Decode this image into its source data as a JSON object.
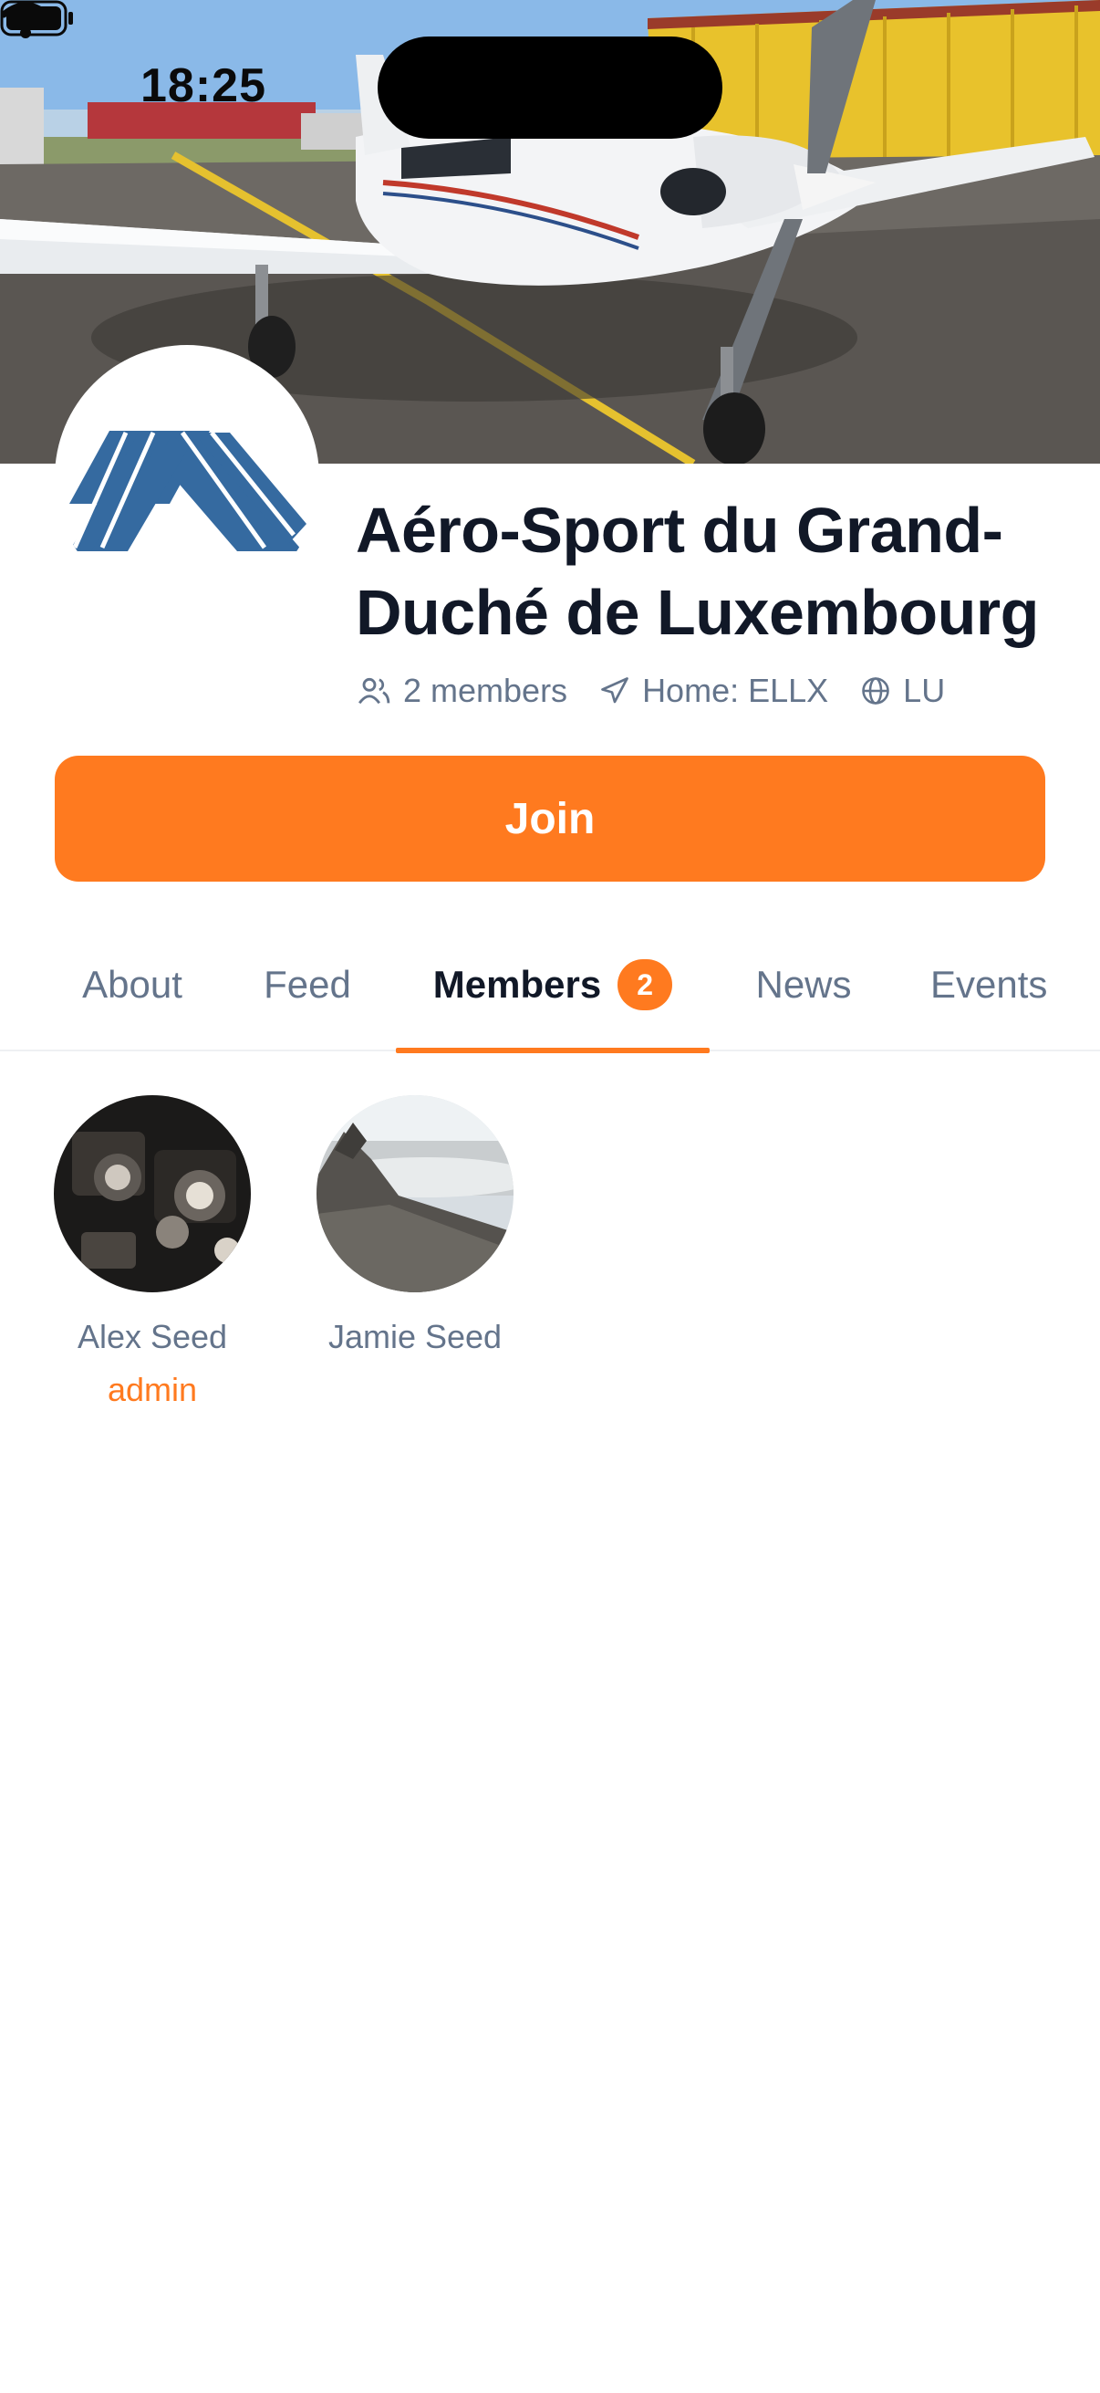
{
  "status_bar": {
    "time": "18:25"
  },
  "group": {
    "name": "Aéro-Sport du Grand-Duché de Luxembourg",
    "members_count": "2 members",
    "home": "Home: ELLX",
    "country": "LU"
  },
  "actions": {
    "join_label": "Join"
  },
  "tabs": [
    {
      "label": "About"
    },
    {
      "label": "Feed"
    },
    {
      "label": "Members",
      "badge": "2"
    },
    {
      "label": "News"
    },
    {
      "label": "Events"
    }
  ],
  "members": [
    {
      "name": "Alex Seed",
      "role": "admin"
    },
    {
      "name": "Jamie Seed"
    }
  ],
  "colors": {
    "accent": "#ff7a1f",
    "muted_text": "#64748b",
    "title_text": "#111827",
    "logo_blue": "#356aa0"
  },
  "icons": [
    "users-icon",
    "plane-icon",
    "globe-icon",
    "wifi-icon",
    "battery-icon"
  ]
}
